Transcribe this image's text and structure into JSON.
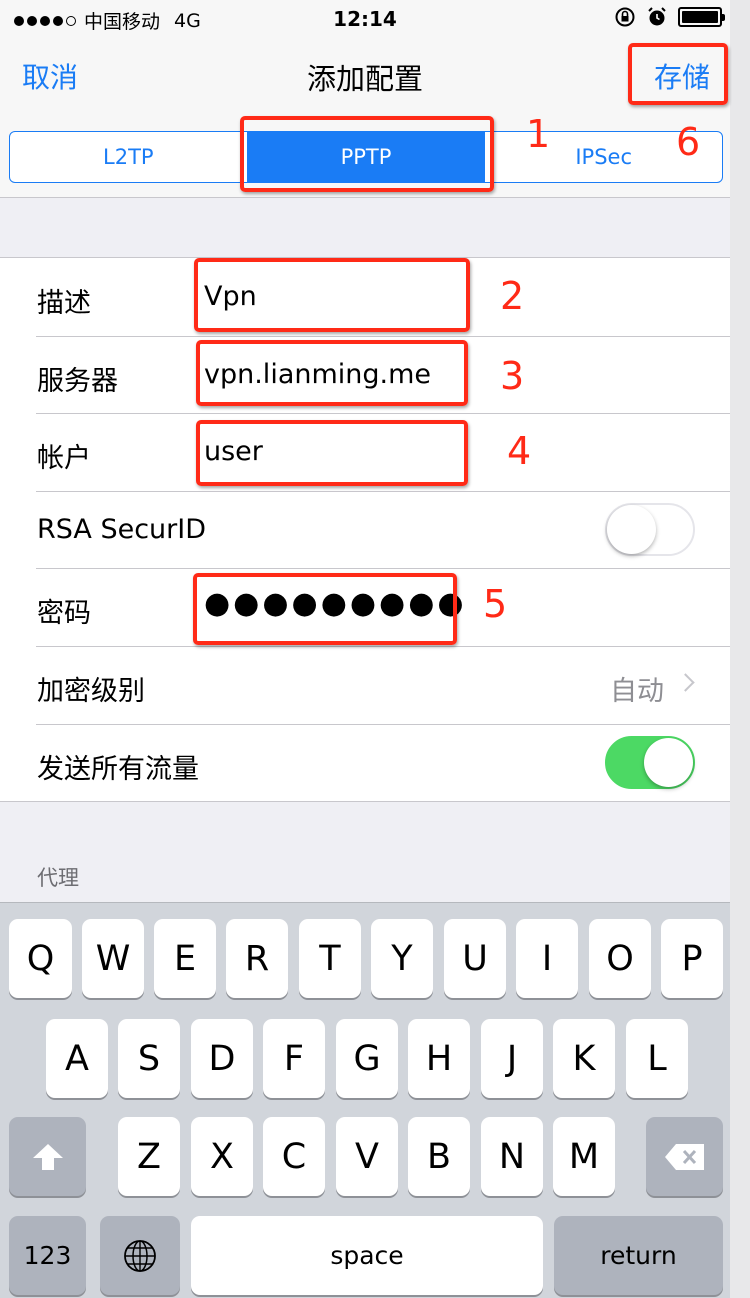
{
  "status_bar": {
    "carrier": "中国移动",
    "network": "4G",
    "time": "12:14",
    "battery_percent": 100
  },
  "nav": {
    "cancel_label": "取消",
    "title": "添加配置",
    "save_label": "存储"
  },
  "segments": [
    {
      "label": "L2TP",
      "active": false
    },
    {
      "label": "PPTP",
      "active": true
    },
    {
      "label": "IPSec",
      "active": false
    }
  ],
  "form": {
    "description": {
      "label": "描述",
      "value": "Vpn"
    },
    "server": {
      "label": "服务器",
      "value": "vpn.lianming.me"
    },
    "account": {
      "label": "帐户",
      "value": "user"
    },
    "rsa": {
      "label": "RSA SecurID",
      "on": false
    },
    "password": {
      "label": "密码",
      "value": "●●●●●●●●●"
    },
    "encryption": {
      "label": "加密级别",
      "value": "自动"
    },
    "send_all": {
      "label": "发送所有流量",
      "on": true
    }
  },
  "proxy_header": "代理",
  "keyboard": {
    "row1": [
      "Q",
      "W",
      "E",
      "R",
      "T",
      "Y",
      "U",
      "I",
      "O",
      "P"
    ],
    "row2": [
      "A",
      "S",
      "D",
      "F",
      "G",
      "H",
      "J",
      "K",
      "L"
    ],
    "row3": [
      "Z",
      "X",
      "C",
      "V",
      "B",
      "N",
      "M"
    ],
    "numbers_label": "123",
    "space_label": "space",
    "return_label": "return"
  },
  "annotations": [
    "1",
    "2",
    "3",
    "4",
    "5",
    "6"
  ],
  "colors": {
    "accent": "#1a7cf5",
    "toggle_on": "#4cd964",
    "annotation": "#ff2a17"
  }
}
